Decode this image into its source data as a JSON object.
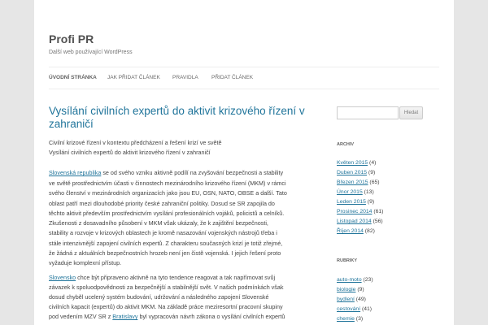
{
  "site": {
    "title": "Profi PR",
    "description": "Další web používající WordPress"
  },
  "nav": [
    {
      "label": "ÚVODNÍ STRÁNKA",
      "current": true
    },
    {
      "label": "JAK PŘIDAT ČLÁNEK",
      "current": false
    },
    {
      "label": "PRAVIDLA",
      "current": false
    },
    {
      "label": "PŘIDAT ČLÁNEK",
      "current": false
    }
  ],
  "post": {
    "title": "Vysílání civilních expertů do aktivit krizového řízení v zahraničí",
    "lines": [
      {
        "text": "Civilní krizové řízení v kontextu předcházení a řešení krizí ve světě"
      },
      {
        "text": "Vysílání civilních expertů do aktivit krizového řízení v zahraničí"
      },
      {
        "link": "Slovenská republika",
        "text": " se od svého vzniku aktivně podílí na zvyšování bezpečnosti a stability"
      },
      {
        "text": "ve světě prostřednictvím účasti v činnostech mezinárodního krizového řízení (MKM) v rámci"
      },
      {
        "text": "svého členství v mezinárodních organizacích jako jsou EU, OSN, NATO, OBSE a další. Tato"
      },
      {
        "text": "oblast patří mezi dlouhodobé priority české zahraniční politiky. Dosud se SR zapojila do"
      },
      {
        "text": "těchto aktivit především prostřednictvím vysílání profesionálních vojáků, policistů a celníků."
      },
      {
        "text": "Zkušenosti z dosavadního působení v MKM však ukázaly, že k zajištění bezpečnosti,"
      },
      {
        "text": "stability a rozvoje v krizových oblastech je kromě nasazování vojenských nástrojů třeba i"
      },
      {
        "text": "stále intenzivnější zapojení civilních expertů. Z charakteru současných krizí je totiž zřejmé,"
      },
      {
        "text": "že žádná z aktuálních bezpečnostních hrozeb není jen čistě vojenská. I jejich řešení proto"
      },
      {
        "text": "vyžaduje komplexní přístup."
      },
      {
        "link": "Slovensko",
        "text": " chce být připraveno aktivně na tyto tendence reagovat a tak napřímovat svůj"
      },
      {
        "text": "závazek k spoluodpovědnosti za bezpečnější a stabilnější svět. V našich podmínkách však"
      },
      {
        "text": "dosud chyběl ucelený systém budování, udržování a následného zapojení Slovenské"
      },
      {
        "text": "civilních kapacit (expertů) do aktivit MKM. Na základě práce meziresortní pracovní skupiny"
      },
      {
        "text": "pod vedením MZV SR z ",
        "link": "Bratislavy",
        "after": " byl vypracován návrh zákona o vysílání civilních expertů"
      }
    ]
  },
  "sidebar": {
    "search_button": "Hledat",
    "archive_title": "ARCHIV",
    "archive": [
      {
        "label": "Květen 2015",
        "count": " (4)"
      },
      {
        "label": "Duben 2015",
        "count": " (9)"
      },
      {
        "label": "Březen 2015",
        "count": " (65)"
      },
      {
        "label": "Únor 2015",
        "count": " (13)"
      },
      {
        "label": "Leden 2015",
        "count": " (9)"
      },
      {
        "label": "Prosinec 2014",
        "count": " (61)"
      },
      {
        "label": "Listopad 2014",
        "count": " (56)"
      },
      {
        "label": "Říjen 2014",
        "count": " (82)"
      }
    ],
    "categories_title": "RUBRIKY",
    "categories": [
      {
        "label": "auto-moto",
        "count": " (23)"
      },
      {
        "label": "biologie",
        "count": " (9)"
      },
      {
        "label": "bydlení",
        "count": " (49)"
      },
      {
        "label": "cestování",
        "count": " (41)"
      },
      {
        "label": "chemie",
        "count": " (3)"
      }
    ]
  }
}
